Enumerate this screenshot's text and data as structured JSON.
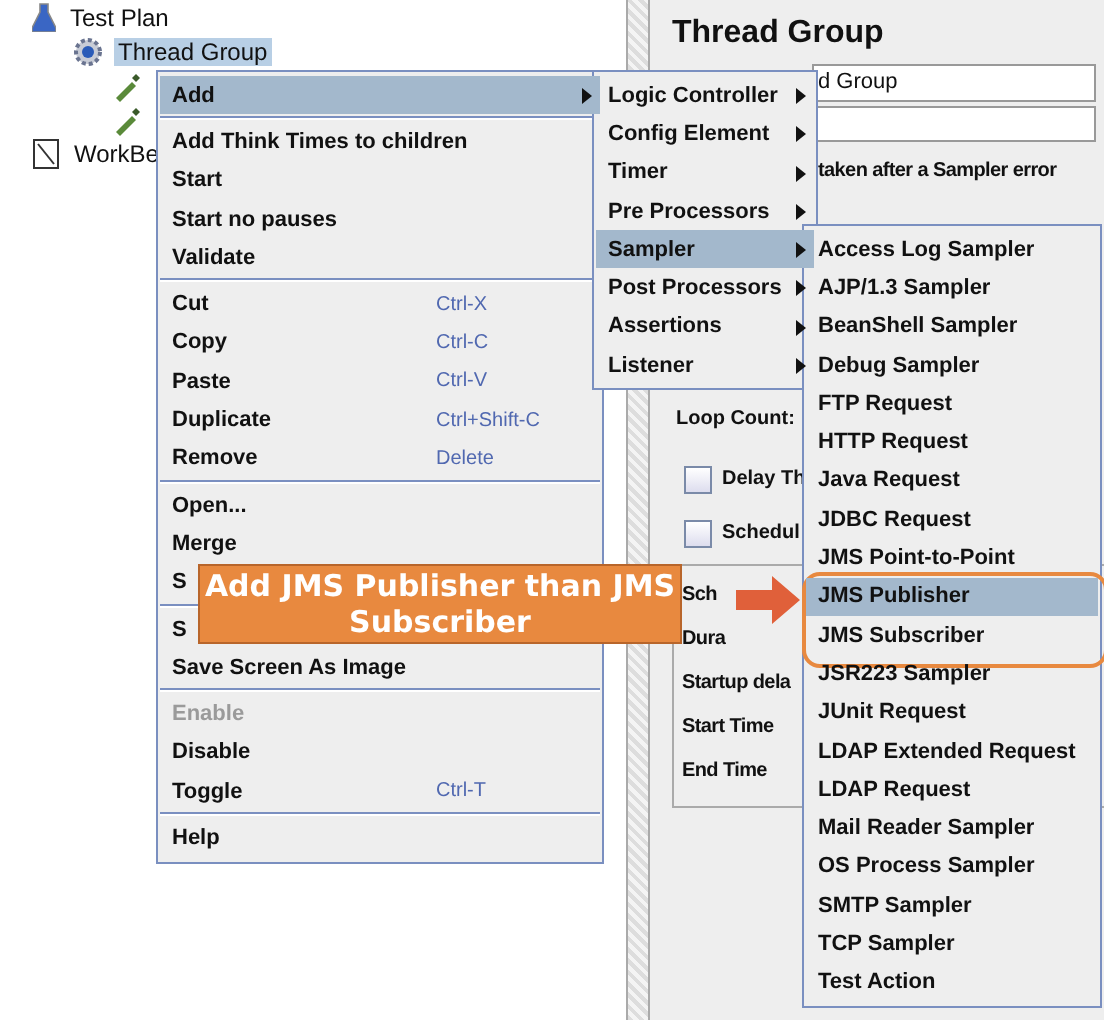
{
  "tree": [
    {
      "label": "Test Plan",
      "kind": "plan",
      "children": [
        {
          "label": "Thread Group",
          "kind": "thread_group",
          "selected": true,
          "children": [
            {
              "kind": "sampler"
            },
            {
              "kind": "sampler"
            }
          ]
        }
      ]
    },
    {
      "label": "WorkBe",
      "kind": "workbench"
    }
  ],
  "panel": {
    "title": "Thread Group",
    "name_value": "d Group",
    "error_action_label": "taken after a Sampler error",
    "loop_count_label": "Loop Count:",
    "checkboxes": [
      {
        "label": "Delay Th",
        "checked": false
      },
      {
        "label": "Schedul",
        "checked": false
      }
    ],
    "scheduler_labels": [
      "Sch",
      "Dura",
      "Startup dela",
      "Start Time",
      "End Time"
    ]
  },
  "context_menu": [
    {
      "kind": "submenu",
      "label": "Add",
      "selected": true
    },
    {
      "kind": "separator"
    },
    {
      "kind": "action",
      "label": "Add Think Times to children",
      "selected": false
    },
    {
      "kind": "action",
      "label": "Start",
      "selected": false
    },
    {
      "kind": "action",
      "label": "Start no pauses",
      "selected": false
    },
    {
      "kind": "action",
      "label": "Validate",
      "selected": false
    },
    {
      "kind": "separator"
    },
    {
      "kind": "action",
      "label": "Cut",
      "shortcut": "Ctrl-X",
      "selected": false
    },
    {
      "kind": "action",
      "label": "Copy",
      "shortcut": "Ctrl-C",
      "selected": false
    },
    {
      "kind": "action",
      "label": "Paste",
      "shortcut": "Ctrl-V",
      "selected": false
    },
    {
      "kind": "action",
      "label": "Duplicate",
      "shortcut": "Ctrl+Shift-C",
      "selected": false
    },
    {
      "kind": "action",
      "label": "Remove",
      "shortcut": "Delete",
      "selected": false
    },
    {
      "kind": "separator"
    },
    {
      "kind": "action",
      "label": "Open...",
      "selected": false
    },
    {
      "kind": "action",
      "label": "Merge",
      "selected": false
    },
    {
      "kind": "action",
      "label": "S",
      "selected": false
    },
    {
      "kind": "separator"
    },
    {
      "kind": "action",
      "label": "S",
      "selected": false
    },
    {
      "kind": "action",
      "label": "Save Screen As Image",
      "selected": false
    },
    {
      "kind": "separator"
    },
    {
      "kind": "action",
      "label": "Enable",
      "disabled": true,
      "selected": false
    },
    {
      "kind": "action",
      "label": "Disable",
      "selected": false
    },
    {
      "kind": "action",
      "label": "Toggle",
      "shortcut": "Ctrl-T",
      "selected": false
    },
    {
      "kind": "separator"
    },
    {
      "kind": "action",
      "label": "Help",
      "selected": false
    }
  ],
  "add_submenu": [
    {
      "kind": "submenu",
      "label": "Logic Controller",
      "selected": false
    },
    {
      "kind": "submenu",
      "label": "Config Element",
      "selected": false
    },
    {
      "kind": "submenu",
      "label": "Timer",
      "selected": false
    },
    {
      "kind": "submenu",
      "label": "Pre Processors",
      "selected": false
    },
    {
      "kind": "submenu",
      "label": "Sampler",
      "selected": true
    },
    {
      "kind": "submenu",
      "label": "Post Processors",
      "selected": false
    },
    {
      "kind": "submenu",
      "label": "Assertions",
      "selected": false
    },
    {
      "kind": "submenu",
      "label": "Listener",
      "selected": false
    }
  ],
  "sampler_submenu": [
    {
      "label": "Access Log Sampler",
      "selected": false
    },
    {
      "label": "AJP/1.3 Sampler",
      "selected": false
    },
    {
      "label": "BeanShell Sampler",
      "selected": false
    },
    {
      "label": "Debug Sampler",
      "selected": false
    },
    {
      "label": "FTP Request",
      "selected": false
    },
    {
      "label": "HTTP Request",
      "selected": false
    },
    {
      "label": "Java Request",
      "selected": false
    },
    {
      "label": "JDBC Request",
      "selected": false
    },
    {
      "label": "JMS Point-to-Point",
      "selected": false
    },
    {
      "label": "JMS Publisher",
      "selected": true,
      "highlighted": true
    },
    {
      "label": "JMS Subscriber",
      "selected": false,
      "highlighted": true
    },
    {
      "label": "JSR223 Sampler",
      "selected": false
    },
    {
      "label": "JUnit Request",
      "selected": false
    },
    {
      "label": "LDAP Extended Request",
      "selected": false
    },
    {
      "label": "LDAP Request",
      "selected": false
    },
    {
      "label": "Mail Reader Sampler",
      "selected": false
    },
    {
      "label": "OS Process Sampler",
      "selected": false
    },
    {
      "label": "SMTP Sampler",
      "selected": false
    },
    {
      "label": "TCP Sampler",
      "selected": false
    },
    {
      "label": "Test Action",
      "selected": false
    }
  ],
  "callout": {
    "text": "Add JMS Publisher than JMS Subscriber"
  }
}
